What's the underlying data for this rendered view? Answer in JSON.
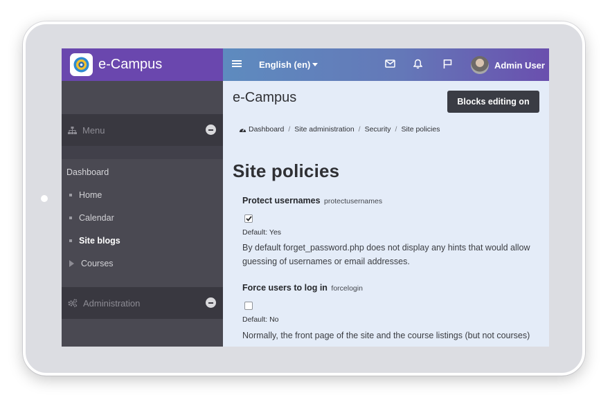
{
  "brand": {
    "name": "e-Campus",
    "logo_icon": "e-campus-logo-icon"
  },
  "navbar": {
    "language": "English (en)",
    "user_name": "Admin User",
    "icons": [
      "menu-icon",
      "mail-icon",
      "bell-icon",
      "flag-icon"
    ]
  },
  "sidebar": {
    "menu_block_title": "Menu",
    "dashboard_label": "Dashboard",
    "items": [
      {
        "label": "Home"
      },
      {
        "label": "Calendar"
      },
      {
        "label": "Site blogs"
      },
      {
        "label": "Courses"
      }
    ],
    "admin_block_title": "Administration"
  },
  "content": {
    "site_title": "e-Campus",
    "editing_button": "Blocks editing on",
    "breadcrumb": [
      "Dashboard",
      "Site administration",
      "Security",
      "Site policies"
    ],
    "page_title": "Site policies",
    "settings": [
      {
        "label": "Protect usernames",
        "key": "protectusernames",
        "checked": true,
        "default": "Default: Yes",
        "description": "By default forget_password.php does not display any hints that would allow guessing of usernames or email addresses."
      },
      {
        "label": "Force users to log in",
        "key": "forcelogin",
        "checked": false,
        "default": "Default: No",
        "description": "Normally, the front page of the site and the course listings (but not courses)"
      }
    ]
  },
  "colors": {
    "brand_purple": "#6a47ae",
    "sidebar_bg": "#4a4952",
    "content_bg": "#e4ecf8",
    "button_dark": "#3a3c44"
  }
}
